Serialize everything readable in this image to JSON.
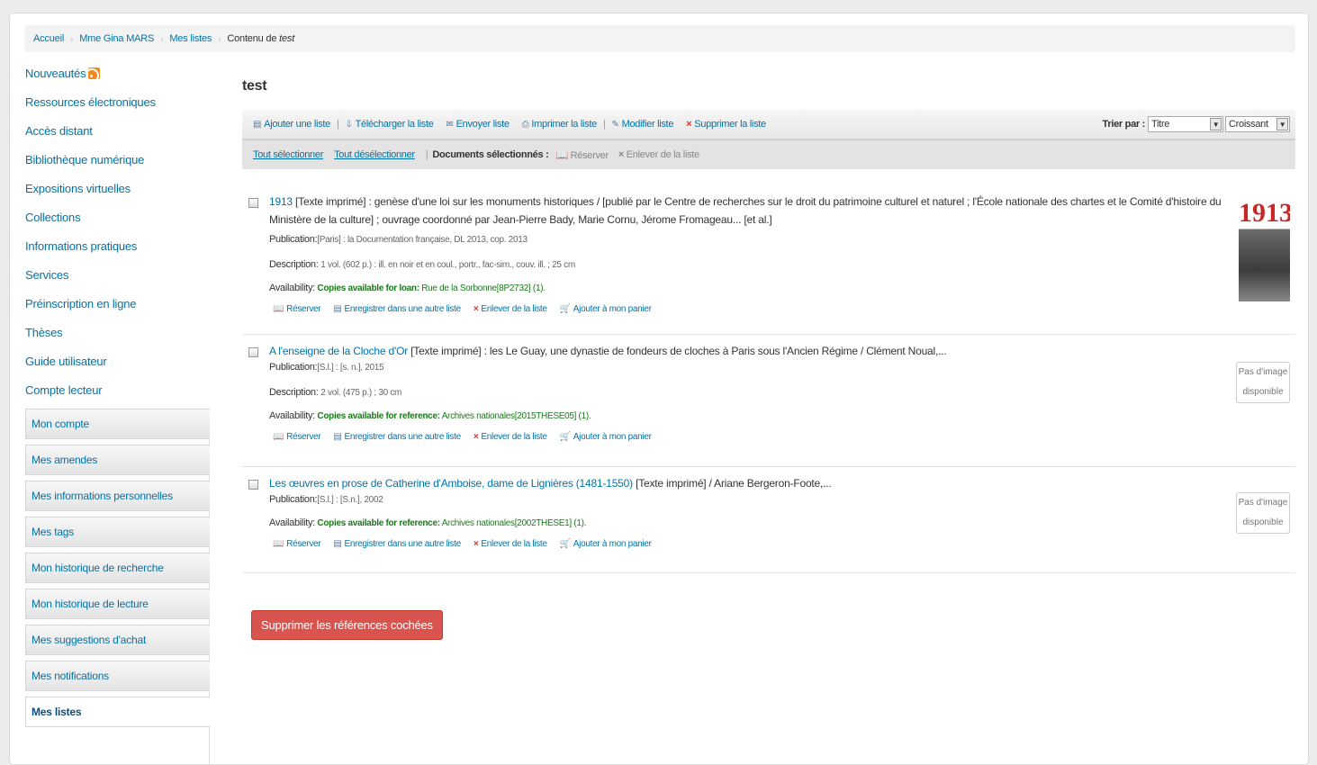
{
  "breadcrumb": {
    "items": [
      "Accueil",
      "Mme Gina MARS",
      "Mes listes"
    ],
    "current_prefix": "Contenu de ",
    "current_list": "test"
  },
  "leftnav": {
    "items": [
      "Nouveautés",
      "Ressources électroniques",
      "Accès distant",
      "Bibliothèque numérique",
      "Expositions virtuelles",
      "Collections",
      "Informations pratiques",
      "Services",
      "Préinscription en ligne",
      "Thèses",
      "Guide utilisateur",
      "Compte lecteur"
    ]
  },
  "usermenu": {
    "items": [
      "Mon compte",
      "Mes amendes",
      "Mes informations personnelles",
      "Mes tags",
      "Mon historique de recherche",
      "Mon historique de lecture",
      "Mes suggestions d'achat",
      "Mes notifications",
      "Mes listes"
    ],
    "active": "Mes listes"
  },
  "list": {
    "title": "test",
    "toolbar": {
      "add": "Ajouter une liste",
      "download": "Télécharger la liste",
      "send": "Envoyer liste",
      "print": "Imprimer la liste",
      "edit": "Modifier liste",
      "delete": "Supprimer la liste",
      "sort_label": "Trier par :",
      "sort_field": "Titre",
      "sort_order": "Croissant"
    },
    "selection": {
      "select_all": "Tout sélectionner",
      "deselect_all": "Tout désélectionner",
      "selected_label": "Documents sélectionnés :",
      "reserve": "Réserver",
      "remove": "Enlever de la liste"
    }
  },
  "records": [
    {
      "title": "1913",
      "rest": " [Texte imprimé] : genèse d'une loi sur les monuments historiques / [publié par le Centre de recherches sur le droit du patrimoine culturel et naturel ; l'École nationale des chartes et le Comité d'histoire du Ministère de la culture] ; ouvrage coordonné par Jean-Pierre Bady, Marie Cornu, Jérome Fromageau... [et al.]",
      "publication_label": "Publication:",
      "publication": "[Paris] : la Documentation française, DL 2013, cop. 2013",
      "description_label": "Description:",
      "description": "1 vol. (602 p.) : ill. en noir et en coul., portr., fac-sim., couv. ill. ; 25 cm",
      "availability_label": "Availability:",
      "availability_status": "Copies available for loan:",
      "availability_value": "Rue de la Sorbonne[8P2732] (1).",
      "cover_text": "1913"
    },
    {
      "title": "A l'enseigne de la Cloche d'Or",
      "rest": " [Texte imprimé] : les Le Guay, une dynastie de fondeurs de cloches à Paris sous l'Ancien Régime / Clément Noual,...",
      "publication_label": "Publication:",
      "publication": "[S.l.] : [s. n.], 2015",
      "description_label": "Description:",
      "description": "2 vol. (475 p.) ; 30 cm",
      "availability_label": "Availability:",
      "availability_status": "Copies available for reference:",
      "availability_value": "Archives nationales[2015THESE05] (1).",
      "noimg_line1": "Pas d'image",
      "noimg_line2": "disponible"
    },
    {
      "title": "Les œuvres en prose de Catherine d'Amboise, dame de Lignières (1481-1550)",
      "rest": " [Texte imprimé] / Ariane Bergeron-Foote,...",
      "publication_label": "Publication:",
      "publication": "[S.l.] : [S.n.], 2002",
      "availability_label": "Availability:",
      "availability_status": "Copies available for reference:",
      "availability_value": "Archives nationales[2002THESE1] (1).",
      "noimg_line1": "Pas d'image",
      "noimg_line2": "disponible"
    }
  ],
  "record_actions": {
    "reserve": "Réserver",
    "save_other": "Enregistrer dans une autre liste",
    "remove": "Enlever de la liste",
    "cart": "Ajouter à mon panier"
  },
  "delete_checked": "Supprimer les références cochées"
}
